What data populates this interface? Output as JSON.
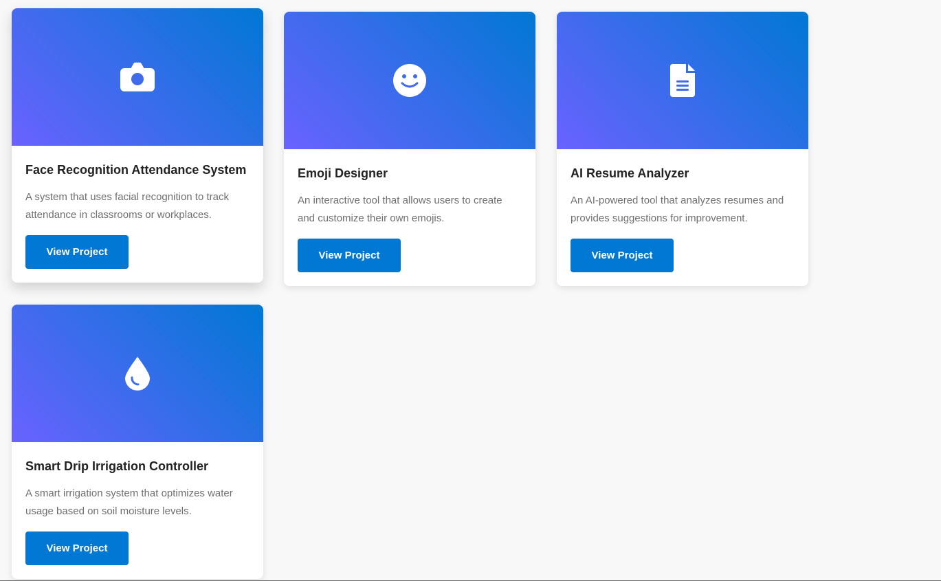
{
  "theme": {
    "gradient_start": "#6a62ff",
    "gradient_end": "#0078d4",
    "button_color": "#0078d4"
  },
  "projects": [
    {
      "icon": "camera-icon",
      "title": "Face Recognition Attendance System",
      "description": "A system that uses facial recognition to track attendance in classrooms or workplaces.",
      "button_label": "View Project"
    },
    {
      "icon": "smile-icon",
      "title": "Emoji Designer",
      "description": "An interactive tool that allows users to create and customize their own emojis.",
      "button_label": "View Project"
    },
    {
      "icon": "document-icon",
      "title": "AI Resume Analyzer",
      "description": "An AI-powered tool that analyzes resumes and provides suggestions for improvement.",
      "button_label": "View Project"
    },
    {
      "icon": "water-drop-icon",
      "title": "Smart Drip Irrigation Controller",
      "description": "A smart irrigation system that optimizes water usage based on soil moisture levels.",
      "button_label": "View Project"
    }
  ]
}
